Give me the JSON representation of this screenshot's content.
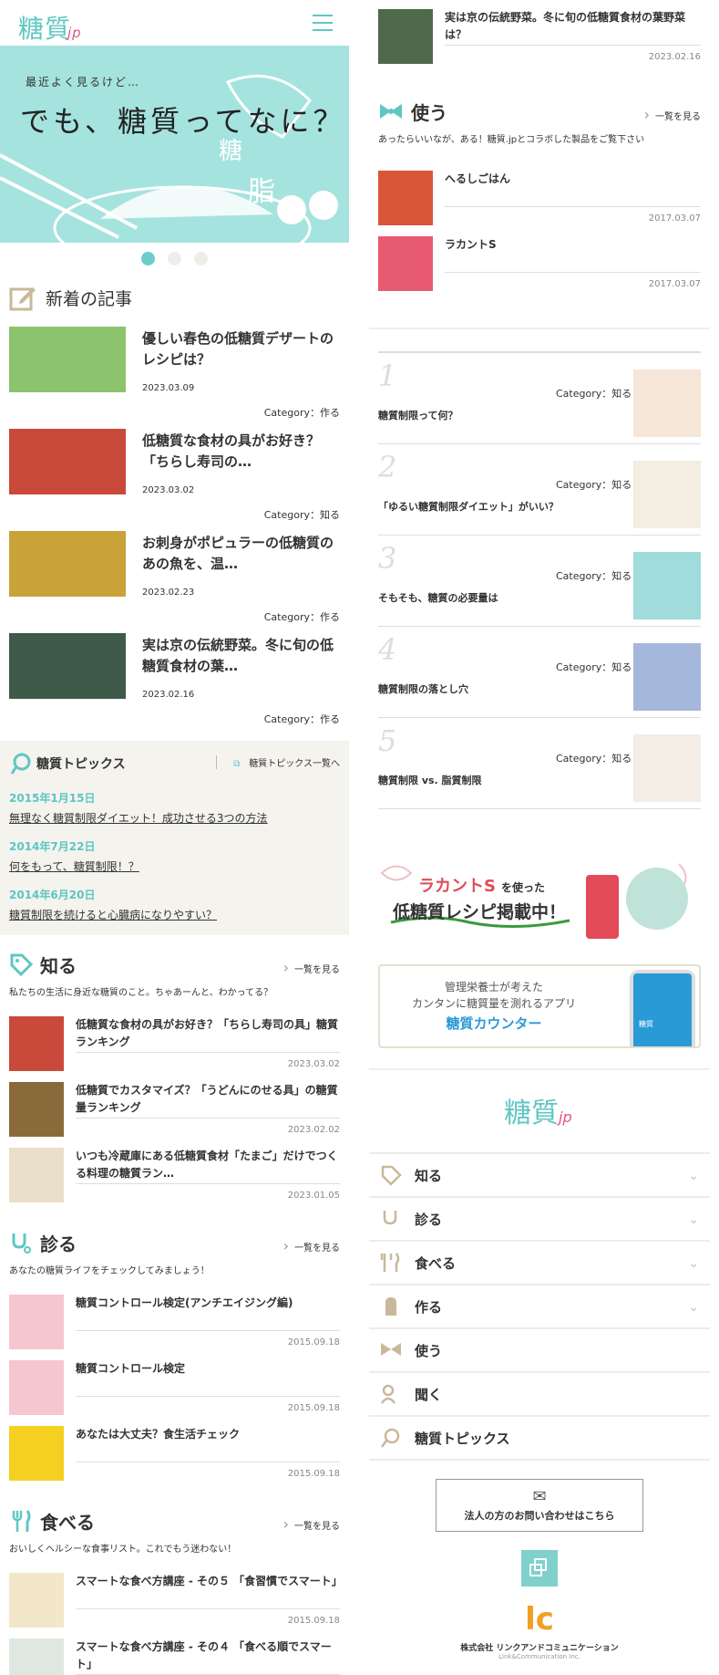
{
  "header": {
    "logo": "糖質",
    "logo_jp": "jp"
  },
  "hero": {
    "sub": "最近よく見るけど…",
    "headline": "でも、糖質ってなに？",
    "kanji1": "糖",
    "kanji2": "脂"
  },
  "news": {
    "title": "新着の記事",
    "items": [
      {
        "title": "優しい春色の低糖質デザートのレシピは？",
        "date": "2023.03.09",
        "cat_label": "Category：",
        "cat": "作る"
      },
      {
        "title": "低糖質な食材の具がお好き？「ちらし寿司の…",
        "date": "2023.03.02",
        "cat_label": "Category：",
        "cat": "知る"
      },
      {
        "title": "お刺身がポピュラーの低糖質のあの魚を、温…",
        "date": "2023.02.23",
        "cat_label": "Category：",
        "cat": "作る"
      },
      {
        "title": "実は京の伝統野菜。冬に旬の低糖質食材の葉…",
        "date": "2023.02.16",
        "cat_label": "Category：",
        "cat": "作る"
      }
    ]
  },
  "topics": {
    "title": "糖質トピックス",
    "link": "糖質トピックス一覧へ",
    "items": [
      {
        "date": "2015年1月15日",
        "text": "無理なく糖質制限ダイエット！成功させる3つの方法"
      },
      {
        "date": "2014年7月22日",
        "text": "何をもって、糖質制限！？"
      },
      {
        "date": "2014年6月20日",
        "text": "糖質制限を続けると心臓病になりやすい？"
      }
    ]
  },
  "shiru": {
    "title": "知る",
    "more": "一覧を見る",
    "sub": "私たちの生活に身近な糖質のこと。ちゃあーんと、わかってる？",
    "items": [
      {
        "title": "低糖質な食材の具がお好き？「ちらし寿司の具」糖質ランキング",
        "date": "2023.03.02"
      },
      {
        "title": "低糖質でカスタマイズ？「うどんにのせる具」の糖質量ランキング",
        "date": "2023.02.02"
      },
      {
        "title": "いつも冷蔵庫にある低糖質食材「たまご」だけでつくる料理の糖質ラン…",
        "date": "2023.01.05"
      }
    ]
  },
  "miru": {
    "title": "診る",
    "more": "一覧を見る",
    "sub": "あなたの糖質ライフをチェックしてみましょう！",
    "items": [
      {
        "title": "糖質コントロール検定(アンチエイジング編)",
        "date": "2015.09.18"
      },
      {
        "title": "糖質コントロール検定",
        "date": "2015.09.18"
      },
      {
        "title": "あなたは大丈夫？食生活チェック",
        "date": "2015.09.18"
      }
    ]
  },
  "taberu": {
    "title": "食べる",
    "more": "一覧を見る",
    "sub": "おいしくヘルシーな食事リスト。これでもう迷わない！",
    "items": [
      {
        "title": "スマートな食べ方講座 - その５ 「食習慣でスマート」",
        "date": "2015.09.18"
      },
      {
        "title": "スマートな食べ方講座 - その４ 「食べる順でスマート」",
        "date": ""
      }
    ]
  },
  "tsukuru_top": {
    "title": "実は京の伝統野菜。冬に旬の低糖質食材の葉野菜は？",
    "date": "2023.02.16"
  },
  "tsukau": {
    "title": "使う",
    "more": "一覧を見る",
    "sub": "あったらいいなが、ある！糖質.jpとコラボした製品をご覧下さい",
    "items": [
      {
        "title": "へるしごはん",
        "date": "2017.03.07"
      },
      {
        "title": "ラカントS",
        "date": "2017.03.07"
      }
    ]
  },
  "ranking": [
    {
      "num": "1",
      "cat_label": "Category：",
      "cat": "知る",
      "title": "糖質制限って何？"
    },
    {
      "num": "2",
      "cat_label": "Category：",
      "cat": "知る",
      "title": "「ゆるい糖質制限ダイエット」がいい？"
    },
    {
      "num": "3",
      "cat_label": "Category：",
      "cat": "知る",
      "title": "そもそも、糖質の必要量は"
    },
    {
      "num": "4",
      "cat_label": "Category：",
      "cat": "知る",
      "title": "糖質制限の落とし穴"
    },
    {
      "num": "5",
      "cat_label": "Category：",
      "cat": "知る",
      "title": "糖質制限 vs. 脂質制限"
    }
  ],
  "banner1": {
    "brand": "ラカントS",
    "brand_suffix": "を使った",
    "line2": "低糖質レシピ掲載中！"
  },
  "banner2": {
    "line1": "管理栄養士が考えた",
    "line2": "カンタンに糖質量を測れるアプリ",
    "line3": "糖質カウンター",
    "phone_label": "糖質"
  },
  "footer_menu": [
    {
      "label": "知る",
      "chevron": true
    },
    {
      "label": "診る",
      "chevron": true
    },
    {
      "label": "食べる",
      "chevron": true
    },
    {
      "label": "作る",
      "chevron": true
    },
    {
      "label": "使う",
      "chevron": false
    },
    {
      "label": "聞く",
      "chevron": false
    },
    {
      "label": "糖質トピックス",
      "chevron": false
    }
  ],
  "contact": {
    "label": "法人の方のお問い合わせはこちら"
  },
  "company": {
    "logo": "lc",
    "name": "株式会社 リンクアンドコミュニケーション",
    "name_en": "Link&Communication Inc."
  },
  "colors": {
    "accent": "#5fc7c3",
    "pink": "#e0557a",
    "beige": "#f4f3ee"
  }
}
